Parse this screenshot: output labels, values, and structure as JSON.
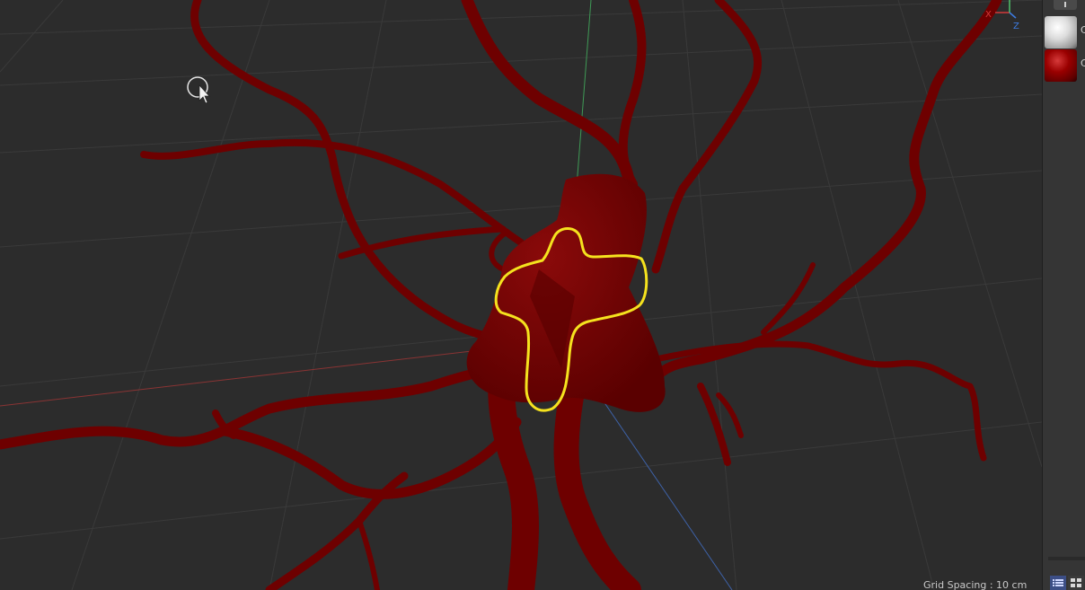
{
  "viewport": {
    "grid_spacing_label": "Grid Spacing : 10 cm",
    "axis_gizmo": {
      "x_label": "X",
      "z_label": "Z",
      "x_color": "#d33a3a",
      "y_color": "#4fc36a",
      "z_color": "#3d7be0"
    },
    "background_color": "#2c2c2c",
    "object_color": "#6e0000",
    "selection_outline_color": "#f5e21e"
  },
  "material_panel": {
    "materials": [
      {
        "name": "C",
        "swatch": "white-sphere"
      },
      {
        "name": "C",
        "swatch": "red-sphere"
      }
    ],
    "view_modes": [
      {
        "name": "list-view-icon",
        "active": true
      },
      {
        "name": "grid-view-icon",
        "active": false
      }
    ]
  }
}
